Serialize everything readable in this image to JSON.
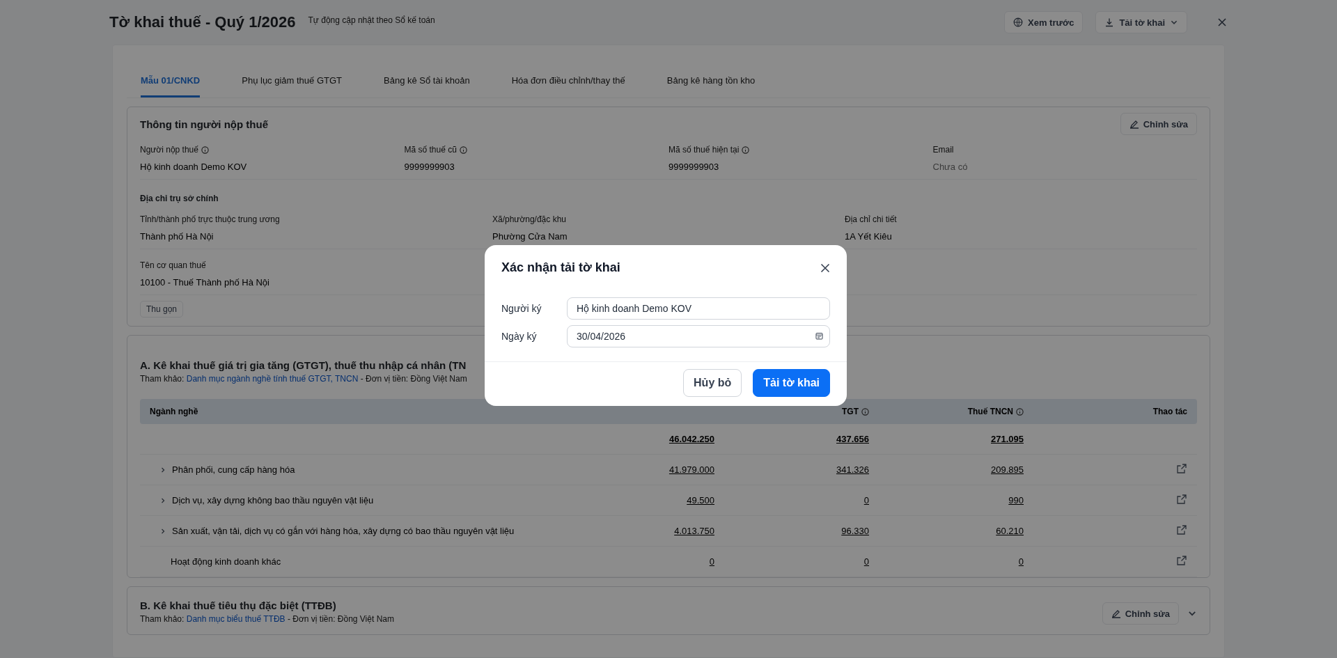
{
  "header": {
    "title": "Tờ khai thuế - Quý 1/2026",
    "subtitle": "Tự động cập nhật theo Sổ kế toán",
    "actions": [
      {
        "kind": "preview",
        "label": "Xem trước"
      },
      {
        "kind": "download",
        "label": "Tải tờ khai"
      }
    ]
  },
  "tabs": [
    {
      "label": "Mẫu 01/CNKD",
      "selected": true
    },
    {
      "label": "Phụ lục giảm thuế GTGT",
      "selected": false
    },
    {
      "label": "Bảng kê Sổ tài khoản",
      "selected": false
    },
    {
      "label": "Hóa đơn điều chỉnh/thay thế",
      "selected": false
    },
    {
      "label": "Bảng kê hàng tồn kho",
      "selected": false
    }
  ],
  "taxpayer": {
    "title": "Thông tin người nộp thuế",
    "edit": "Chỉnh sửa",
    "fields": [
      {
        "label": "Người nộp thuế",
        "info": true,
        "value": "Hộ kinh doanh Demo KOV",
        "empty": false
      },
      {
        "label": "Mã số thuế cũ",
        "info": true,
        "value": "9999999903",
        "empty": false
      },
      {
        "label": "Mã số thuế hiện tại",
        "info": true,
        "value": "9999999903",
        "empty": false
      },
      {
        "label": "Email",
        "info": false,
        "value": "Chưa có",
        "empty": true
      }
    ],
    "address_title": "Địa chỉ trụ sở chính",
    "address_fields": [
      {
        "label": "Tỉnh/thành phố trực thuộc trung ương",
        "value": "Thành phố Hà Nội"
      },
      {
        "label": "Xã/phường/đặc khu",
        "value": "Phường Cửa Nam"
      },
      {
        "label": "Địa chỉ chi tiết",
        "value": "1A Yết Kiêu"
      }
    ],
    "office": {
      "label": "Tên cơ quan thuế",
      "value": "10100 - Thuế Thành phố Hà Nội"
    },
    "collapse": "Thu gọn"
  },
  "section_a": {
    "title": "A. Kê khai thuế giá trị gia tăng (GTGT), thuế thu nhập cá nhân (TN",
    "note_prefix": "Tham khảo:",
    "note_link": "Danh mục ngành nghề tính thuế GTGT, TNCN",
    "note_suffix": "- Đơn vị tiền: Đồng Việt Nam",
    "header": {
      "column_1": {
        "label": "Ngành nghề",
        "info": false
      },
      "column_3": {
        "label": "TGT",
        "info": true
      },
      "column_4": {
        "label": "Thuế TNCN",
        "info": true
      },
      "column_5": {
        "label": "Thao tác",
        "info": false
      }
    },
    "total": [
      "46.042.250",
      "437.656",
      "271.095"
    ],
    "rows": [
      {
        "name": "Phân phối, cung cấp hàng hóa",
        "expandable": true,
        "values": [
          "41.979.000",
          "341.326",
          "209.895"
        ]
      },
      {
        "name": "Dịch vụ, xây dựng không bao thầu nguyên vật liệu",
        "expandable": true,
        "values": [
          "49.500",
          "0",
          "990"
        ]
      },
      {
        "name": "Sản xuất, vận tải, dịch vụ có gắn với hàng hóa, xây dựng có bao thầu nguyên vật liệu",
        "expandable": true,
        "values": [
          "4.013.750",
          "96.330",
          "60.210"
        ]
      },
      {
        "name": "Hoạt động kinh doanh khác",
        "expandable": false,
        "values": [
          "0",
          "0",
          "0"
        ]
      }
    ]
  },
  "section_b": {
    "title": "B. Kê khai thuế tiêu thụ đặc biệt (TTĐB)",
    "note_prefix": "Tham khảo:",
    "note_link": "Danh mục biểu thuế TTĐB",
    "note_suffix": "- Đơn vị tiền: Đồng Việt Nam",
    "edit": "Chỉnh sửa"
  },
  "dialog": {
    "title": "Xác nhận tải tờ khai",
    "fields": [
      {
        "kind": "text",
        "label": "Người ký",
        "value": "Hộ kinh doanh Demo KOV"
      },
      {
        "kind": "date",
        "label": "Ngày ký",
        "value": "30/04/2026"
      }
    ],
    "buttons": [
      {
        "kind": "secondary",
        "label": "Hủy bỏ"
      },
      {
        "kind": "primary",
        "label": "Tải tờ khai"
      }
    ]
  }
}
